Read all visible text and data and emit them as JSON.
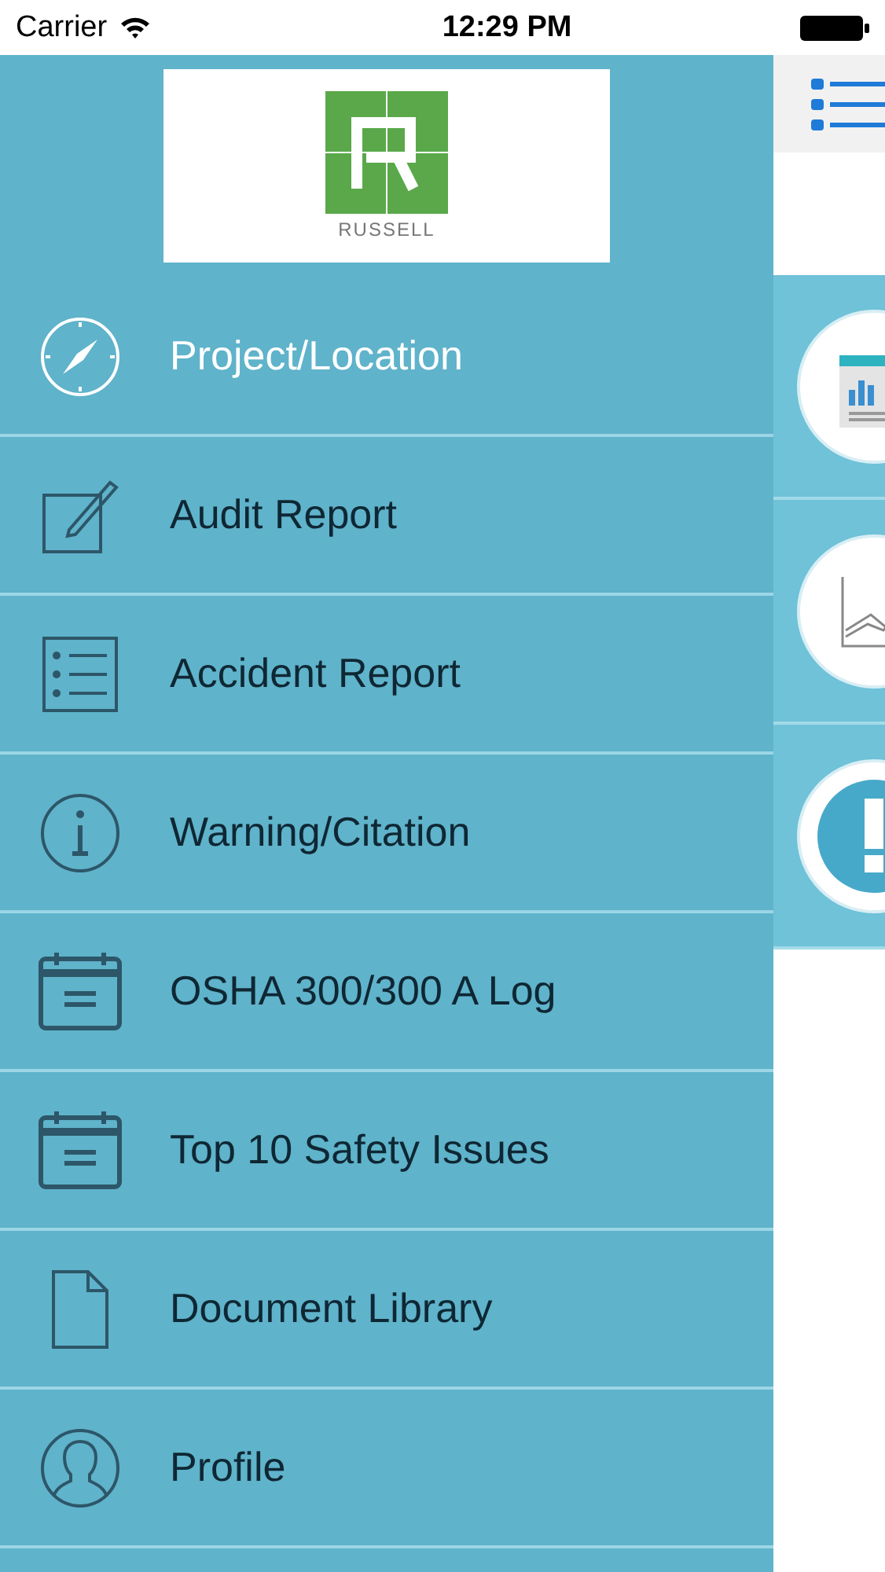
{
  "status_bar": {
    "carrier": "Carrier",
    "time": "12:29 PM"
  },
  "logo": {
    "text": "RUSSELL"
  },
  "menu": {
    "items": [
      {
        "label": "Project/Location",
        "kind": "compass",
        "selected": true
      },
      {
        "label": "Audit Report",
        "kind": "edit",
        "selected": false
      },
      {
        "label": "Accident Report",
        "kind": "list",
        "selected": false
      },
      {
        "label": "Warning/Citation",
        "kind": "info",
        "selected": false
      },
      {
        "label": "OSHA 300/300 A Log",
        "kind": "calendar",
        "selected": false
      },
      {
        "label": "Top 10 Safety Issues",
        "kind": "calendar",
        "selected": false
      },
      {
        "label": "Document Library",
        "kind": "document",
        "selected": false
      },
      {
        "label": "Profile",
        "kind": "user",
        "selected": false
      }
    ]
  },
  "main": {
    "tiles": [
      {
        "kind": "report"
      },
      {
        "kind": "chart"
      },
      {
        "kind": "alert"
      }
    ]
  }
}
